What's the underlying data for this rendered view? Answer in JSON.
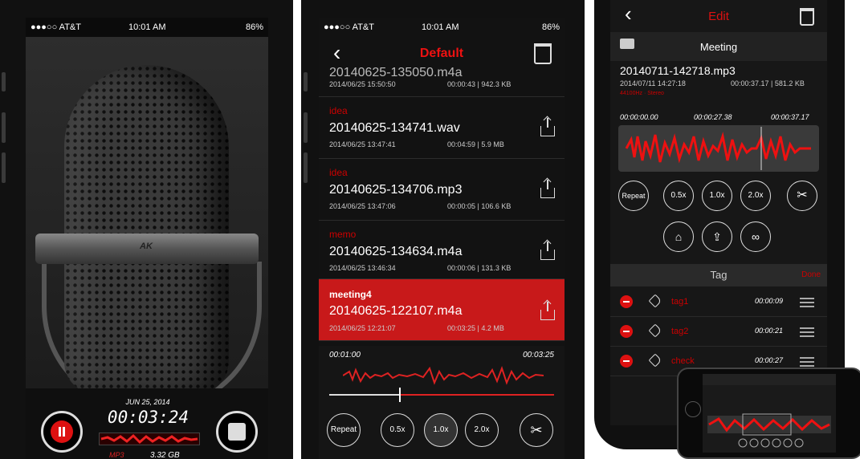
{
  "status": {
    "carrier": "●●●○○ AT&T",
    "time": "10:01 AM",
    "battery": "86%"
  },
  "recorder": {
    "date": "JUN 25, 2014",
    "timer": "00:03:24",
    "format": "MP3",
    "free_space": "3.32 GB",
    "mic_logo": "AK"
  },
  "list": {
    "title": "Default",
    "partial_row": {
      "filename": "20140625-135050.m4a",
      "date": "2014/06/25 15:50:50",
      "info": "00:00:43 | 942.3 KB"
    },
    "rows": [
      {
        "tag": "idea",
        "filename": "20140625-134741.wav",
        "date": "2014/06/25 13:47:41",
        "info": "00:04:59 | 5.9 MB"
      },
      {
        "tag": "idea",
        "filename": "20140625-134706.mp3",
        "date": "2014/06/25 13:47:06",
        "info": "00:00:05 | 106.6 KB"
      },
      {
        "tag": "memo",
        "filename": "20140625-134634.m4a",
        "date": "2014/06/25 13:46:34",
        "info": "00:00:06 | 131.3 KB"
      },
      {
        "tag": "meeting4",
        "filename": "20140625-122107.m4a",
        "date": "2014/06/25 12:21:07",
        "info": "00:03:25 | 4.2 MB"
      }
    ],
    "player": {
      "time_current": "00:01:00",
      "time_total": "00:03:25",
      "buttons": [
        "Repeat",
        "0.5x",
        "1.0x",
        "2.0x"
      ]
    }
  },
  "editor": {
    "title": "Edit",
    "recording_title": "Meeting",
    "filename": "20140711-142718.mp3",
    "date": "2014/07/11 14:27:18",
    "info": "00:00:37.17 | 581.2 KB",
    "subinfo": "44100Hz · Stereo",
    "times": [
      "00:00:00.00",
      "00:00:27.38",
      "00:00:37.17"
    ],
    "buttons": [
      "Repeat",
      "0.5x",
      "1.0x",
      "2.0x"
    ],
    "tag_header": "Tag",
    "done_label": "Done",
    "tags": [
      {
        "name": "tag1",
        "time": "00:00:09"
      },
      {
        "name": "tag2",
        "time": "00:00:21"
      },
      {
        "name": "check",
        "time": "00:00:27"
      }
    ]
  },
  "colors": {
    "accent": "#d11a1a",
    "background": "#151515"
  }
}
